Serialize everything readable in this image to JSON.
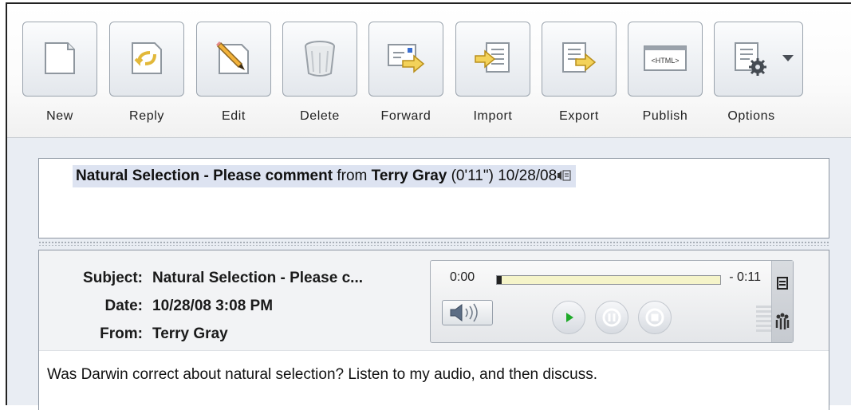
{
  "toolbar": {
    "buttons": [
      {
        "label": "New",
        "icon": "new-document-icon"
      },
      {
        "label": "Reply",
        "icon": "reply-icon"
      },
      {
        "label": "Edit",
        "icon": "edit-pencil-icon"
      },
      {
        "label": "Delete",
        "icon": "trash-can-icon"
      },
      {
        "label": "Forward",
        "icon": "forward-icon"
      },
      {
        "label": "Import",
        "icon": "import-icon"
      },
      {
        "label": "Export",
        "icon": "export-icon"
      },
      {
        "label": "Publish",
        "icon": "html-publish-icon"
      },
      {
        "label": "Options",
        "icon": "options-gear-icon"
      }
    ],
    "publish_icon_text": "<HTML>"
  },
  "message_list": {
    "rows": [
      {
        "subject": "Natural Selection - Please comment",
        "from_word": "from",
        "author": "Terry Gray",
        "duration": "(0'11\")",
        "date": "10/28/08"
      }
    ]
  },
  "message": {
    "subject_label": "Subject:",
    "subject": "Natural Selection - Please c...",
    "date_label": "Date:",
    "date": "10/28/08 3:08 PM",
    "from_label": "From:",
    "from": "Terry Gray",
    "body": "Was Darwin correct about natural selection?  Listen to my audio, and then discuss."
  },
  "player": {
    "elapsed": "0:00",
    "remaining": "- 0:11",
    "progress": 0.02
  },
  "colors": {
    "selection": "#dde3f1",
    "play_green": "#1faa2a",
    "track": "#f5f4c9"
  }
}
